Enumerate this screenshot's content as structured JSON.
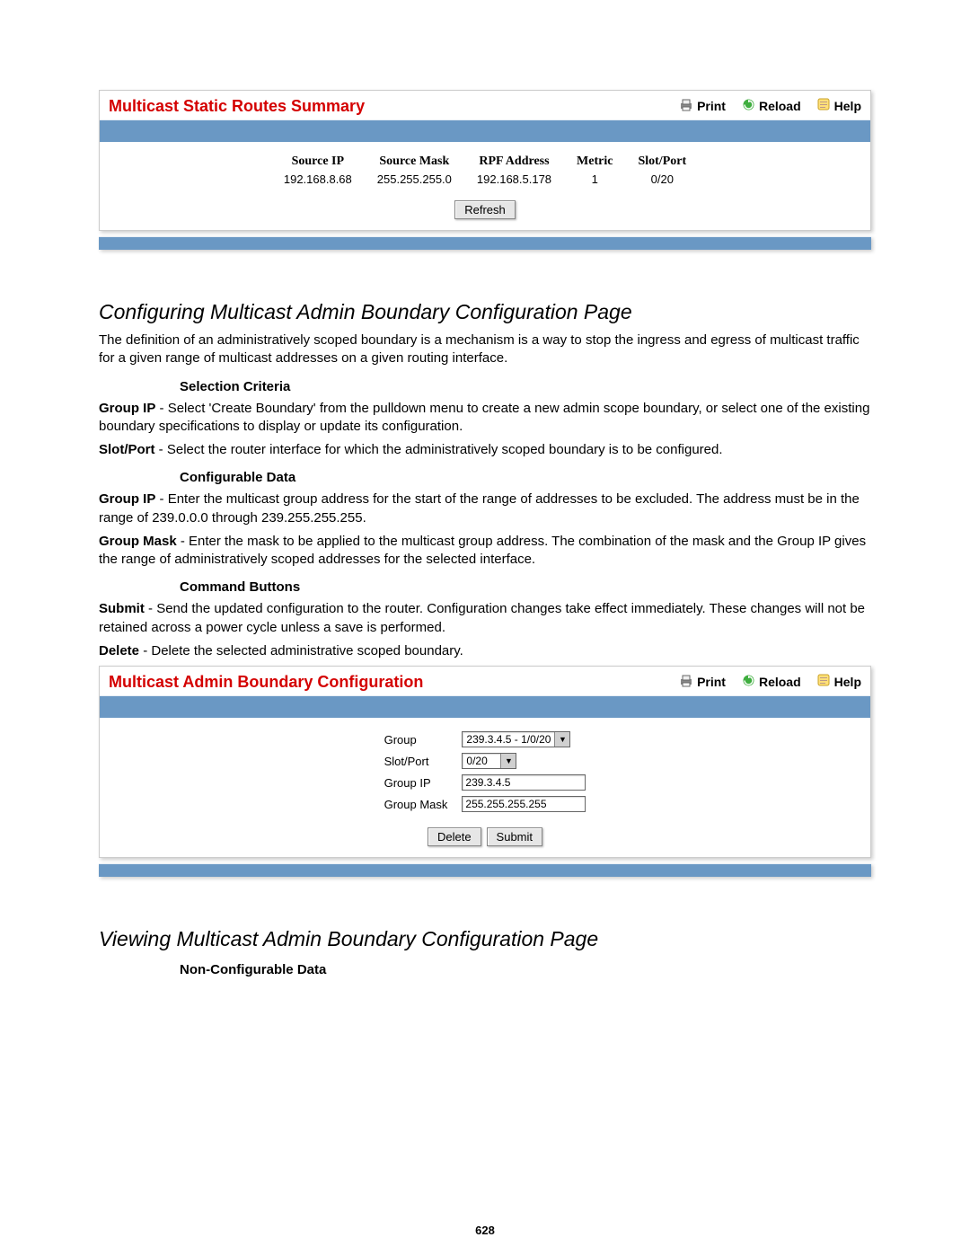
{
  "panel1": {
    "title": "Multicast Static Routes Summary",
    "hdr_print": "Print",
    "hdr_reload": "Reload",
    "hdr_help": "Help",
    "table": {
      "cols": [
        "Source IP",
        "Source Mask",
        "RPF Address",
        "Metric",
        "Slot/Port"
      ],
      "row": [
        "192.168.8.68",
        "255.255.255.0",
        "192.168.5.178",
        "1",
        "0/20"
      ]
    },
    "refresh_label": "Refresh"
  },
  "sect1": {
    "heading": "Configuring Multicast Admin Boundary Configuration Page",
    "intro": "The definition of an administratively scoped boundary is a mechanism is a way to stop the ingress and egress of multicast traffic for a given range of multicast addresses on a given routing interface.",
    "selcrit_head": "Selection Criteria",
    "groupip_sel": "Select 'Create Boundary' from the pulldown menu to create a new admin scope boundary, or select one of the existing boundary specifications to display or update its configuration.",
    "slotport_sel": "Select the router interface for which the administratively scoped boundary is to be configured.",
    "confdata_head": "Configurable Data",
    "groupip_cfg": "Enter the multicast group address for the start of the range of addresses to be excluded. The address must be in the range of 239.0.0.0 through 239.255.255.255.",
    "groupmask_cfg": "Enter the mask to be applied to the multicast group address. The combination of the mask and the Group IP gives the range of administratively scoped addresses for the selected interface.",
    "cmdbtn_head": "Command Buttons",
    "submit_txt": "Send the updated configuration to the router. Configuration changes take effect immediately. These changes will not be retained across a power cycle unless a save is performed.",
    "delete_txt": "Delete the selected administrative scoped boundary.",
    "terms": {
      "group_ip": "Group IP",
      "slot_port": "Slot/Port",
      "group_mask": "Group Mask",
      "submit": "Submit",
      "delete": "Delete"
    }
  },
  "panel2": {
    "title": "Multicast Admin Boundary Configuration",
    "hdr_print": "Print",
    "hdr_reload": "Reload",
    "hdr_help": "Help",
    "labels": {
      "group": "Group",
      "slotport": "Slot/Port",
      "groupip": "Group IP",
      "groupmask": "Group Mask"
    },
    "values": {
      "group": "239.3.4.5 - 1/0/20",
      "slotport": "0/20",
      "groupip": "239.3.4.5",
      "groupmask": "255.255.255.255"
    },
    "delete_label": "Delete",
    "submit_label": "Submit"
  },
  "sect2": {
    "heading": "Viewing Multicast Admin Boundary Configuration Page",
    "nonconf_head": "Non-Configurable Data"
  },
  "page_number": "628"
}
